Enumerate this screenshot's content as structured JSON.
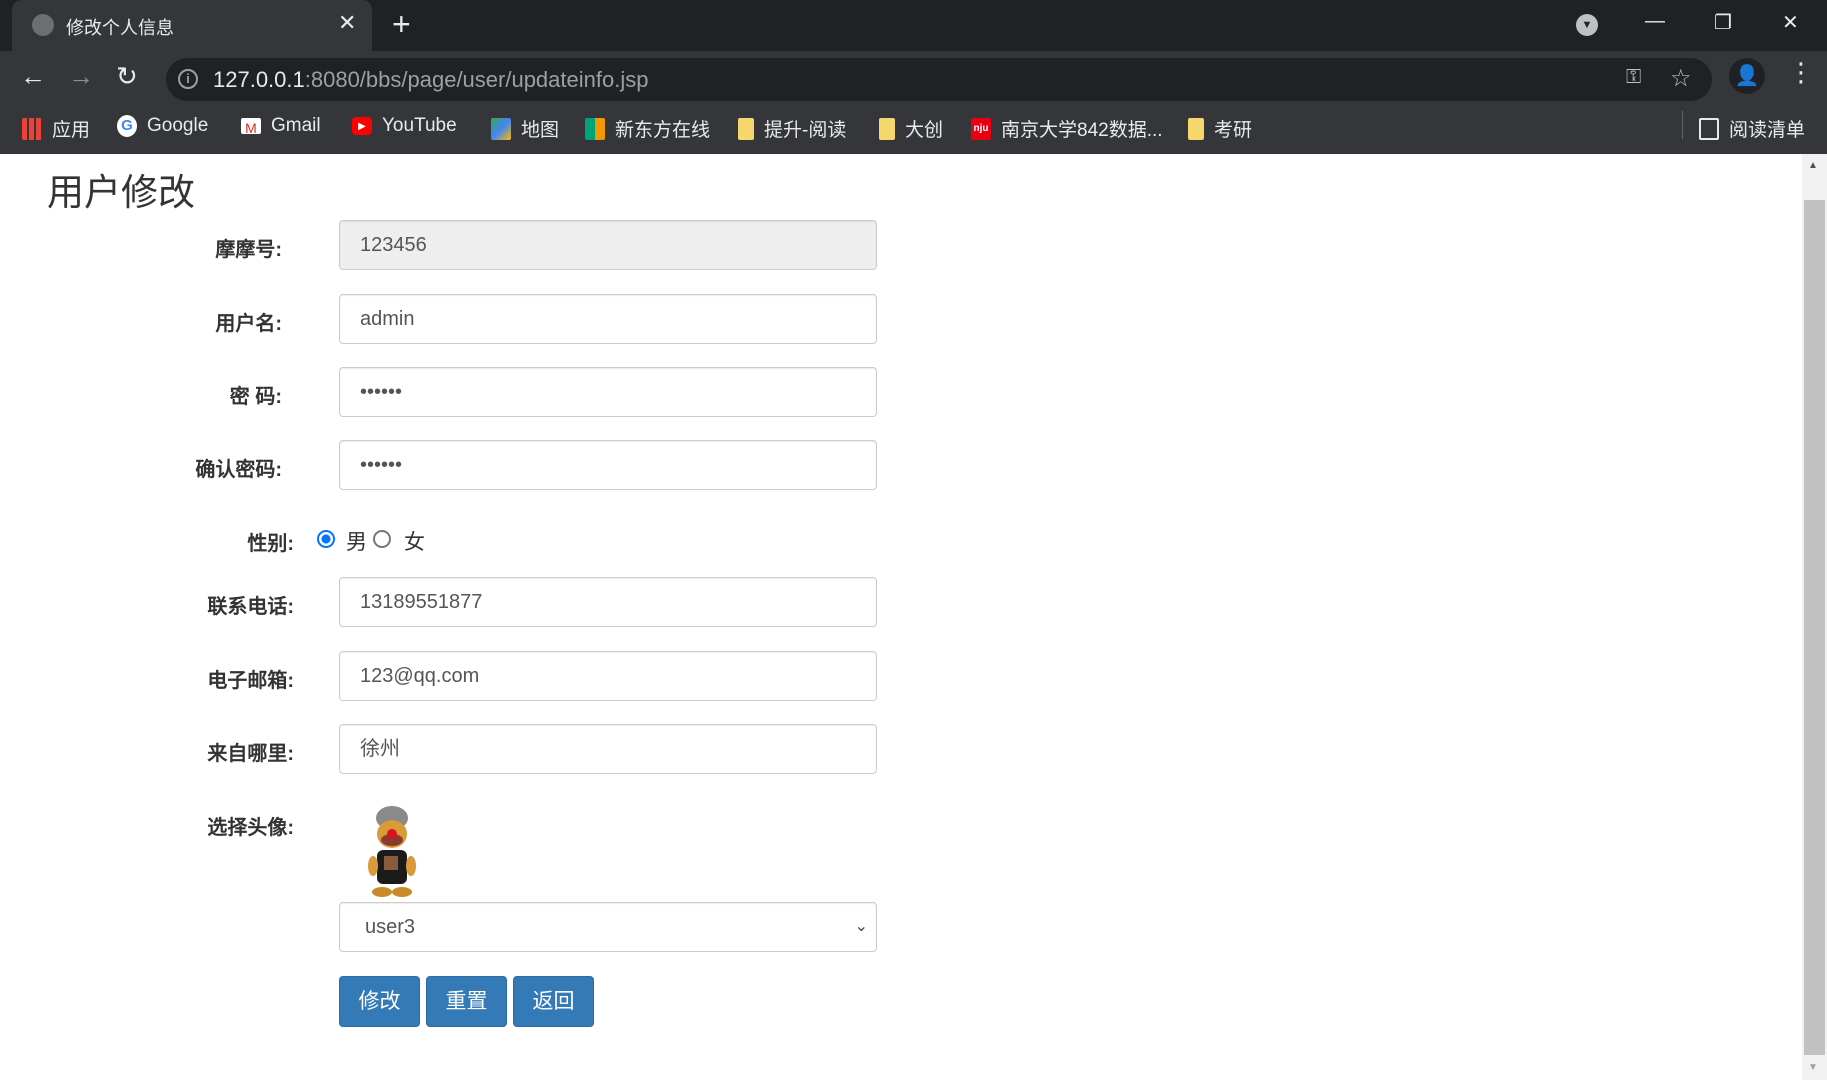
{
  "browser": {
    "tab_title": "修改个人信息",
    "url_host": "127.0.0.1",
    "url_rest": ":8080/bbs/page/user/updateinfo.jsp",
    "bookmarks": [
      {
        "label": "应用",
        "icon": "apps-grid-icon"
      },
      {
        "label": "Google",
        "icon": "google-icon"
      },
      {
        "label": "Gmail",
        "icon": "gmail-icon"
      },
      {
        "label": "YouTube",
        "icon": "youtube-icon"
      },
      {
        "label": "地图",
        "icon": "maps-icon"
      },
      {
        "label": "新东方在线",
        "icon": "xdf-icon"
      },
      {
        "label": "提升-阅读",
        "icon": "folder-icon"
      },
      {
        "label": "大创",
        "icon": "folder-icon"
      },
      {
        "label": "南京大学842数据...",
        "icon": "nju-icon"
      },
      {
        "label": "考研",
        "icon": "folder-icon"
      }
    ],
    "reading_list": "阅读清单"
  },
  "page": {
    "title": "用户修改",
    "fields": {
      "momo_label": "摩摩号:",
      "momo_value": "123456",
      "username_label": "用户名:",
      "username_value": "admin",
      "password_label": "密 码:",
      "password_value": "••••••",
      "confirm_label": "确认密码:",
      "confirm_value": "••••••",
      "gender_label": "性别:",
      "gender_male": "男",
      "gender_female": "女",
      "gender_selected": "男",
      "phone_label": "联系电话:",
      "phone_value": "13189551877",
      "email_label": "电子邮箱:",
      "email_value": "123@qq.com",
      "from_label": "来自哪里:",
      "from_value": "徐州",
      "avatar_label": "选择头像:",
      "avatar_value": "user3"
    },
    "buttons": {
      "submit": "修改",
      "reset": "重置",
      "back": "返回"
    },
    "colors": {
      "primary": "#337ab7",
      "radio": "#0075ff"
    }
  }
}
